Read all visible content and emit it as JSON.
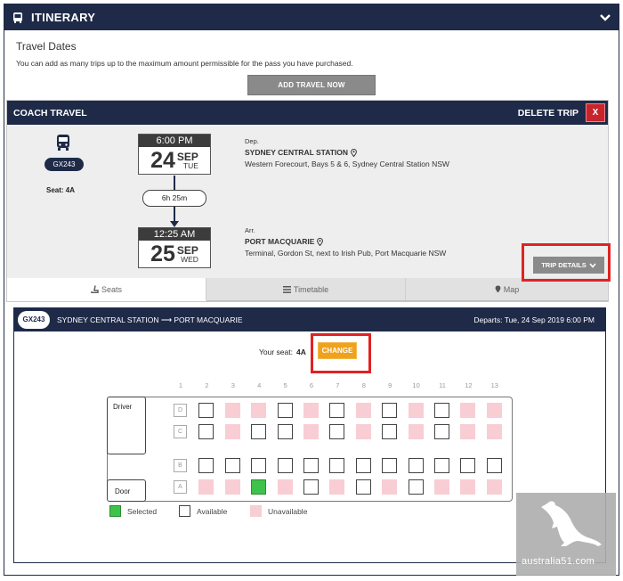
{
  "header": {
    "title": "ITINERARY",
    "icon": "bus-icon",
    "toggle_icon": "chevron-down-icon"
  },
  "travel_dates": {
    "heading": "Travel Dates",
    "description": "You can add as many trips up to the maximum amount permissible for the pass you have purchased.",
    "add_button": "ADD TRAVEL NOW"
  },
  "coach": {
    "title": "COACH TRAVEL",
    "delete_label": "DELETE TRIP",
    "delete_x": "X",
    "service_code": "GX243",
    "seat_label": "Seat: 4A",
    "departure": {
      "time": "6:00 PM",
      "day": "24",
      "month": "SEP",
      "weekday": "TUE",
      "tag": "Dep.",
      "station": "SYDNEY CENTRAL STATION",
      "address": "Western Forecourt, Bays 5 & 6, Sydney Central Station NSW"
    },
    "duration": "6h 25m",
    "arrival": {
      "time": "12:25 AM",
      "day": "25",
      "month": "SEP",
      "weekday": "WED",
      "tag": "Arr.",
      "station": "PORT MACQUARIE",
      "address": "Terminal, Gordon St, next to Irish Pub, Port Macquarie NSW"
    },
    "trip_details_label": "TRIP DETAILS"
  },
  "tabs": [
    {
      "label": "Seats",
      "icon": "seat-icon",
      "active": true
    },
    {
      "label": "Timetable",
      "icon": "list-icon",
      "active": false
    },
    {
      "label": "Map",
      "icon": "map-pin-icon",
      "active": false
    }
  ],
  "route": {
    "code": "GX243",
    "title": "SYDNEY CENTRAL STATION ⟶ PORT MACQUARIE",
    "departs": "Departs: Tue, 24 Sep 2019 6:00 PM"
  },
  "seat_picker": {
    "your_seat_label": "Your seat:",
    "your_seat_value": "4A",
    "change_label": "CHANGE"
  },
  "seatmap": {
    "columns": [
      "1",
      "2",
      "3",
      "4",
      "5",
      "6",
      "7",
      "8",
      "9",
      "10",
      "11",
      "12",
      "13"
    ],
    "row_labels": [
      "D",
      "C",
      "B",
      "A"
    ],
    "driver_label": "Driver",
    "door_label": "Door",
    "rows": {
      "D": [
        "",
        "free",
        "un",
        "un",
        "free",
        "un",
        "free",
        "un",
        "free",
        "un",
        "free",
        "un",
        "un"
      ],
      "C": [
        "",
        "free",
        "un",
        "free",
        "free",
        "un",
        "free",
        "un",
        "free",
        "un",
        "free",
        "un",
        "un"
      ],
      "B": [
        "",
        "free",
        "free",
        "free",
        "free",
        "free",
        "free",
        "free",
        "free",
        "free",
        "free",
        "free",
        "free"
      ],
      "A": [
        "",
        "un",
        "un",
        "sel",
        "un",
        "free",
        "un",
        "free",
        "un",
        "free",
        "un",
        "un",
        "un"
      ]
    }
  },
  "legend": [
    {
      "label": "Selected",
      "status": "sel"
    },
    {
      "label": "Available",
      "status": "free"
    },
    {
      "label": "Unavailable",
      "status": "un"
    }
  ],
  "colors": {
    "navy": "#1e2a48",
    "selected": "#3fc24a",
    "unavailable": "#f8cdd4",
    "change": "#f0a21c",
    "delete": "#c8242c",
    "highlight": "#e02222"
  },
  "watermark": {
    "text": "australia51.com"
  }
}
